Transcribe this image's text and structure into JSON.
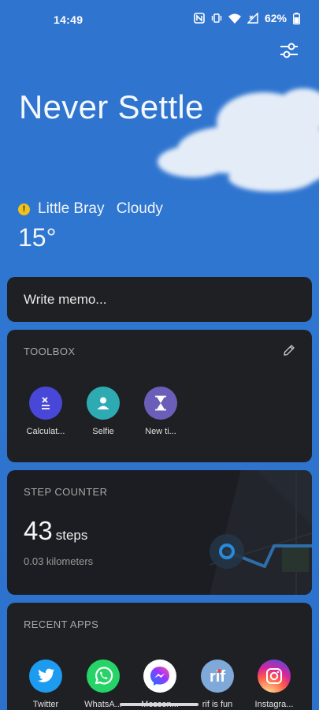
{
  "status_bar": {
    "time": "14:49",
    "battery": "62%",
    "icons": [
      "nfc-icon",
      "vibrate-icon",
      "wifi-icon",
      "signal-icon",
      "battery-icon"
    ]
  },
  "header": {
    "title": "Never Settle",
    "settings_icon": "sliders-icon"
  },
  "weather": {
    "location": "Little Bray",
    "condition": "Cloudy",
    "temperature": "15°",
    "warning_icon": "warning-icon"
  },
  "memo": {
    "placeholder": "Write memo..."
  },
  "toolbox": {
    "heading": "TOOLBOX",
    "edit_icon": "pencil-icon",
    "tools": [
      {
        "label": "Calculat...",
        "icon": "calculator-icon",
        "color": "#4847d8"
      },
      {
        "label": "Selfie",
        "icon": "person-icon",
        "color": "#2eaab3"
      },
      {
        "label": "New ti...",
        "icon": "hourglass-icon",
        "color": "#6a5fb8"
      }
    ]
  },
  "step_counter": {
    "heading": "STEP COUNTER",
    "steps": "43",
    "unit": "steps",
    "distance": "0.03 kilometers"
  },
  "recent_apps": {
    "heading": "RECENT APPS",
    "apps": [
      {
        "label": "Twitter",
        "icon": "twitter-icon",
        "color": "#1d9bf0"
      },
      {
        "label": "WhatsA...",
        "icon": "whatsapp-icon",
        "color": "#25d366"
      },
      {
        "label": "Messen...",
        "icon": "messenger-icon",
        "color": "#ffffff"
      },
      {
        "label": "rif is fun",
        "icon": "rif-icon",
        "color": "#7fa9d9"
      },
      {
        "label": "Instagra...",
        "icon": "instagram-icon",
        "color": "#d62976"
      }
    ]
  }
}
